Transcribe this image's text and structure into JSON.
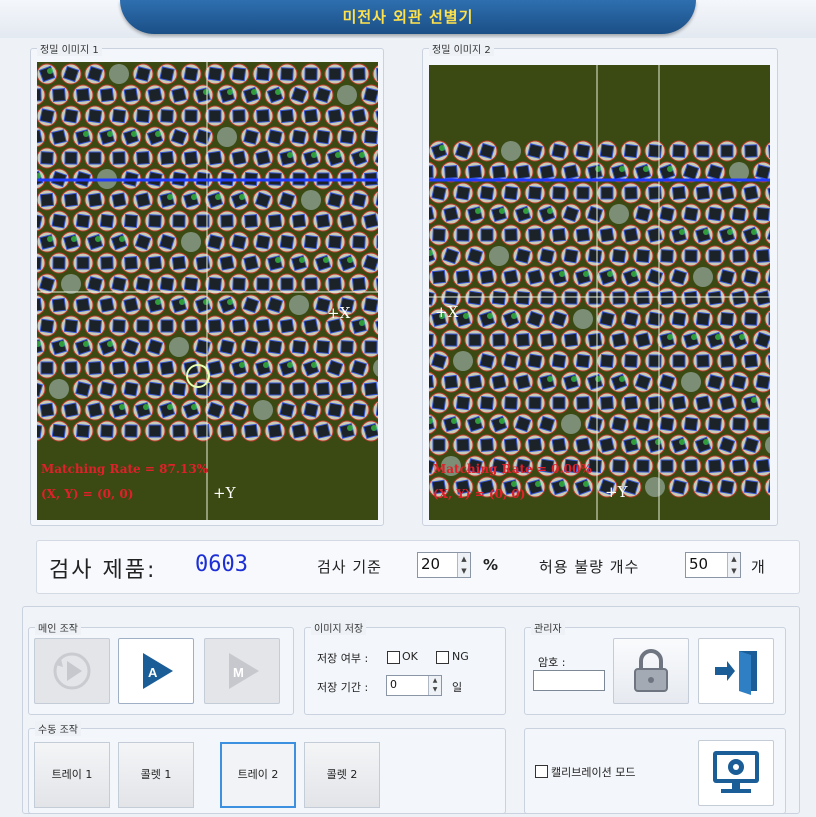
{
  "app": {
    "title": "미전사 외관 선별기"
  },
  "viewers": [
    {
      "label": "정밀 이미지 1",
      "matching_text": "Matching Rate = 87.13%",
      "coord_text": "(X, Y) = (0, 0)",
      "x_axis": "+X",
      "y_axis": "+Y"
    },
    {
      "label": "정밀 이미지 2",
      "matching_text": "Matching Rate = 0.00%",
      "coord_text": "(X, Y) = (0, 0)",
      "x_axis": "+X",
      "y_axis": "+Y"
    }
  ],
  "info": {
    "product_label": "검사 제품:",
    "product_value": "0603",
    "criteria_label": "검사 기준",
    "criteria_value": "20",
    "criteria_unit": "%",
    "allow_label": "허용 불량 개수",
    "allow_value": "50",
    "allow_unit": "개"
  },
  "main_ops": {
    "label": "메인 조작",
    "buttons": [
      {
        "name": "manual-play",
        "icon": "play-refresh-icon",
        "state": "disabled"
      },
      {
        "name": "auto",
        "icon": "auto-play-icon",
        "glyph": "A",
        "state": "active"
      },
      {
        "name": "manual-mode",
        "icon": "manual-play-icon",
        "glyph": "M",
        "state": "disabled"
      }
    ]
  },
  "image_save": {
    "label": "이미지 저장",
    "save_flag_label": "저장 여부 :",
    "ok_label": "OK",
    "ng_label": "NG",
    "period_label": "저장 기간 :",
    "period_value": "0",
    "period_unit": "일"
  },
  "admin": {
    "label": "관리자",
    "password_label": "암호 :",
    "password_value": "",
    "icons": [
      "lock-icon",
      "exit-door-icon"
    ]
  },
  "manual_ops": {
    "label": "수동 조작",
    "buttons": [
      "트레이 1",
      "콜렛 1",
      "트레이 2",
      "콜렛 2"
    ],
    "selected": "트레이 2"
  },
  "calibration": {
    "label": "캘리브레이션 모드",
    "icon": "monitor-settings-icon"
  },
  "colors": {
    "title_bg": "#1b4f86",
    "title_text": "#ffe14a",
    "product_value": "#1c2fd6",
    "overlay_text": "#e0202a",
    "scan_line": "#1f3cff",
    "image_bg": "#3a4a12"
  }
}
